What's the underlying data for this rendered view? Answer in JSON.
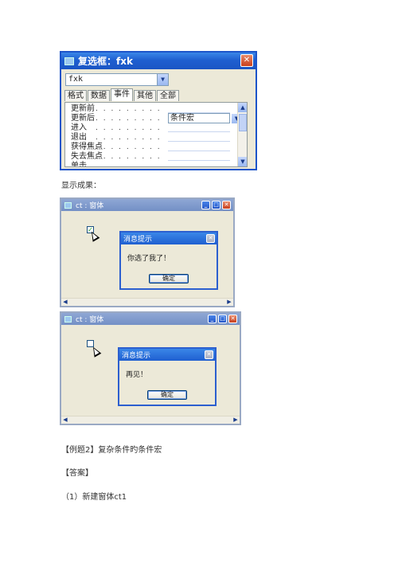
{
  "property_window": {
    "title": "复选框：fxk",
    "object_select": "fxk",
    "tabs": [
      "格式",
      "数据",
      "事件",
      "其他",
      "全部"
    ],
    "active_tab": 2,
    "rows": [
      {
        "name": "更新前",
        "value": ""
      },
      {
        "name": "更新后",
        "value": "条件宏"
      },
      {
        "name": "进入",
        "value": ""
      },
      {
        "name": "退出",
        "value": ""
      },
      {
        "name": "获得焦点",
        "value": ""
      },
      {
        "name": "失去焦点",
        "value": ""
      },
      {
        "name": "单击",
        "value": ""
      }
    ],
    "build_button": "..."
  },
  "caption_result": "显示成果：",
  "form1": {
    "title": "ct : 窗体",
    "checkbox_checked": true,
    "msg_title": "消息提示",
    "msg_text": "你选了我了！",
    "ok_label": "确定"
  },
  "form2": {
    "title": "ct : 窗体",
    "checkbox_checked": false,
    "msg_title": "消息提示",
    "msg_text": "再见！",
    "ok_label": "确定"
  },
  "example_heading": "【例题2】复杂条件旳条件宏",
  "answer_heading": "【答案】",
  "step1": "（1）新建窗体ct1"
}
